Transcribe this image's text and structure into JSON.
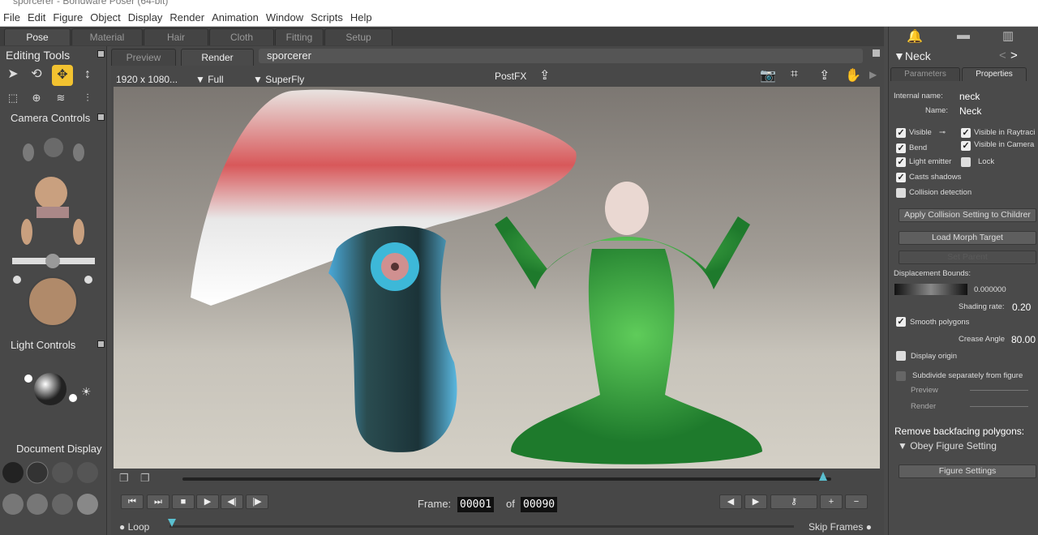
{
  "window": {
    "title": "sporcerer - Bondware Poser (64-bit)"
  },
  "menu": [
    "File",
    "Edit",
    "Figure",
    "Object",
    "Display",
    "Render",
    "Animation",
    "Window",
    "Scripts",
    "Help"
  ],
  "rooms": [
    "Pose",
    "Material",
    "Hair",
    "Cloth",
    "Fitting",
    "Setup"
  ],
  "left": {
    "editing_tools": "Editing Tools",
    "camera_controls": "Camera Controls",
    "light_controls": "Light Controls",
    "document_display": "Document  Display"
  },
  "viewport": {
    "tabs": [
      "Preview",
      "Render"
    ],
    "scene_name": "sporcerer",
    "resolution": "1920 x 1080...",
    "size": "Full",
    "renderer": "SuperFly",
    "postfx": "PostFX"
  },
  "timeline": {
    "frame_label": "Frame:",
    "current_frame": "00001",
    "of_label": "of",
    "total_frames": "00090",
    "loop": "Loop",
    "skip_frames": "Skip Frames"
  },
  "properties": {
    "title": "Neck",
    "tabs": [
      "Parameters",
      "Properties"
    ],
    "internal_name_label": "Internal name:",
    "internal_name": "neck",
    "name_label": "Name:",
    "name": "Neck",
    "checks": [
      {
        "label": "Visible",
        "checked": true
      },
      {
        "label": "Visible in Raytraci",
        "checked": true
      },
      {
        "label": "Bend",
        "checked": true
      },
      {
        "label": "Visible in Camera",
        "checked": true
      },
      {
        "label": "Light emitter",
        "checked": true
      },
      {
        "label": "Lock",
        "checked": false
      },
      {
        "label": "Casts shadows",
        "checked": true
      },
      {
        "label": "Collision detection",
        "checked": false
      }
    ],
    "apply_collision": "Apply Collision Setting to Childrer",
    "load_morph": "Load Morph Target",
    "set_parent": "Set Parent",
    "displacement_label": "Displacement Bounds:",
    "displacement_value": "0.000000",
    "shading_rate_label": "Shading rate:",
    "shading_rate": "0.20",
    "smooth_polygons": "Smooth polygons",
    "smooth_checked": true,
    "crease_angle_label": "Crease Angle",
    "crease_angle": "80.00",
    "display_origin": "Display origin",
    "subdivide": "Subdivide separately from figure",
    "preview": "Preview",
    "render": "Render",
    "backfacing_label": "Remove backfacing polygons:",
    "backfacing_value": "Obey Figure Setting",
    "figure_settings": "Figure Settings"
  },
  "colors": {
    "accent": "#f2c230",
    "bg": "#4a4a4a"
  }
}
